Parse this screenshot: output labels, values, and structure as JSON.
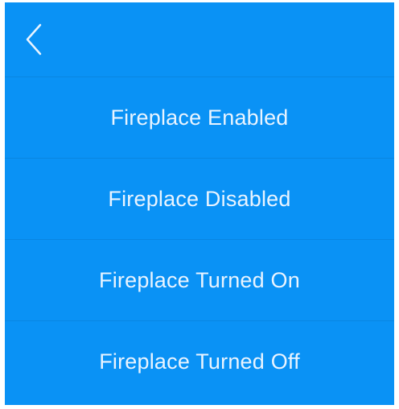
{
  "header": {
    "back_icon": "chevron-left-icon"
  },
  "menu": {
    "items": [
      {
        "label": "Fireplace Enabled"
      },
      {
        "label": "Fireplace Disabled"
      },
      {
        "label": "Fireplace Turned On"
      },
      {
        "label": "Fireplace Turned Off"
      }
    ]
  },
  "colors": {
    "background": "#0a92f5",
    "text": "#e9f4ff"
  }
}
